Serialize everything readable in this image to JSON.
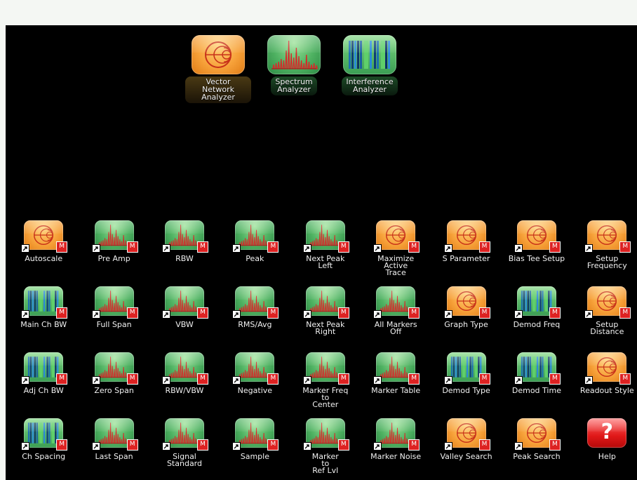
{
  "apps": [
    {
      "name": "vector-network-analyzer",
      "type": "vna",
      "label": "Vector Network\nAnalyzer"
    },
    {
      "name": "spectrum-analyzer",
      "type": "spectrum",
      "label": "Spectrum\nAnalyzer"
    },
    {
      "name": "interference-analyzer",
      "type": "interference",
      "label": "Interference\nAnalyzer"
    }
  ],
  "shortcuts": [
    {
      "type": "vna",
      "label": "Autoscale"
    },
    {
      "type": "spectrum",
      "label": "Pre Amp"
    },
    {
      "type": "spectrum",
      "label": "RBW"
    },
    {
      "type": "spectrum",
      "label": "Peak"
    },
    {
      "type": "spectrum",
      "label": "Next Peak\nLeft"
    },
    {
      "type": "vna",
      "label": "Maximize\nActive\nTrace"
    },
    {
      "type": "vna",
      "label": "S Parameter"
    },
    {
      "type": "vna",
      "label": "Bias Tee Setup"
    },
    {
      "type": "vna",
      "label": "Setup\nFrequency"
    },
    {
      "type": "interference",
      "label": "Main Ch BW"
    },
    {
      "type": "spectrum",
      "label": "Full Span"
    },
    {
      "type": "spectrum",
      "label": "VBW"
    },
    {
      "type": "spectrum",
      "label": "RMS/Avg"
    },
    {
      "type": "spectrum",
      "label": "Next Peak\nRight"
    },
    {
      "type": "spectrum",
      "label": "All Markers\nOff"
    },
    {
      "type": "vna",
      "label": "Graph Type"
    },
    {
      "type": "interference",
      "label": "Demod Freq"
    },
    {
      "type": "vna",
      "label": "Setup\nDistance"
    },
    {
      "type": "interference",
      "label": "Adj Ch BW"
    },
    {
      "type": "spectrum",
      "label": "Zero Span"
    },
    {
      "type": "spectrum",
      "label": "RBW/VBW"
    },
    {
      "type": "spectrum",
      "label": "Negative"
    },
    {
      "type": "spectrum",
      "label": "Marker Freq\nto\nCenter"
    },
    {
      "type": "spectrum",
      "label": "Marker Table"
    },
    {
      "type": "interference",
      "label": "Demod Type"
    },
    {
      "type": "interference",
      "label": "Demod Time"
    },
    {
      "type": "vna",
      "label": "Readout Style"
    },
    {
      "type": "interference",
      "label": "Ch Spacing"
    },
    {
      "type": "spectrum",
      "label": "Last Span"
    },
    {
      "type": "spectrum",
      "label": "Signal\nStandard"
    },
    {
      "type": "spectrum",
      "label": "Sample"
    },
    {
      "type": "spectrum",
      "label": "Marker\nto\nRef Lvl"
    },
    {
      "type": "spectrum",
      "label": "Marker Noise"
    },
    {
      "type": "vna",
      "label": "Valley Search"
    },
    {
      "type": "vna",
      "label": "Peak Search"
    },
    {
      "type": "help",
      "label": "Help"
    }
  ],
  "badges": {
    "m": "M",
    "help_glyph": "?"
  },
  "colors": {
    "screen": "#000000",
    "vna": "#f7a23a",
    "spectrum": "#4fb262",
    "interference": "#3b9e54",
    "help": "#e01818"
  }
}
